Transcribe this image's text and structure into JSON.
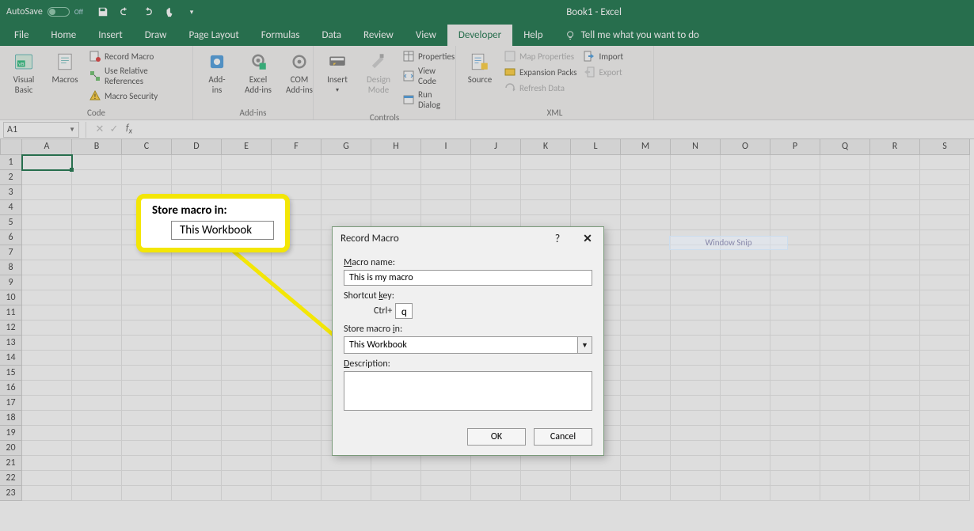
{
  "title": {
    "autosave": "AutoSave",
    "autosave_state": "Off",
    "doc": "Book1 - Excel"
  },
  "tabs": [
    "File",
    "Home",
    "Insert",
    "Draw",
    "Page Layout",
    "Formulas",
    "Data",
    "Review",
    "View",
    "Developer",
    "Help"
  ],
  "active_tab": "Developer",
  "tellme_placeholder": "Tell me what you want to do",
  "ribbon": {
    "code": {
      "visual_basic": "Visual\nBasic",
      "macros": "Macros",
      "record_macro": "Record Macro",
      "use_rel": "Use Relative References",
      "macro_security": "Macro Security",
      "group": "Code"
    },
    "addins": {
      "addins": "Add-\nins",
      "excel_addins": "Excel\nAdd-ins",
      "com_addins": "COM\nAdd-ins",
      "group": "Add-ins"
    },
    "controls": {
      "insert": "Insert",
      "design_mode": "Design\nMode",
      "properties": "Properties",
      "view_code": "View Code",
      "run_dialog": "Run Dialog",
      "group": "Controls"
    },
    "xml": {
      "source": "Source",
      "map_props": "Map Properties",
      "expansion": "Expansion Packs",
      "refresh": "Refresh Data",
      "import": "Import",
      "export": "Export",
      "group": "XML"
    }
  },
  "namebox": "A1",
  "columns": [
    "A",
    "B",
    "C",
    "D",
    "E",
    "F",
    "G",
    "H",
    "I",
    "J",
    "K",
    "L",
    "M",
    "N",
    "O",
    "P",
    "Q",
    "R",
    "S"
  ],
  "row_count": 23,
  "callout": {
    "label": "Store macro in:",
    "value": "This Workbook"
  },
  "dialog": {
    "title": "Record Macro",
    "macro_name_label": "Macro name:",
    "macro_name": "This is my macro",
    "shortcut_label": "Shortcut key:",
    "shortcut_prefix": "Ctrl+",
    "shortcut_key": "q",
    "store_label": "Store macro in:",
    "store_value": "This Workbook",
    "desc_label": "Description:",
    "desc_value": "",
    "ok": "OK",
    "cancel": "Cancel"
  },
  "snip": "Window Snip"
}
